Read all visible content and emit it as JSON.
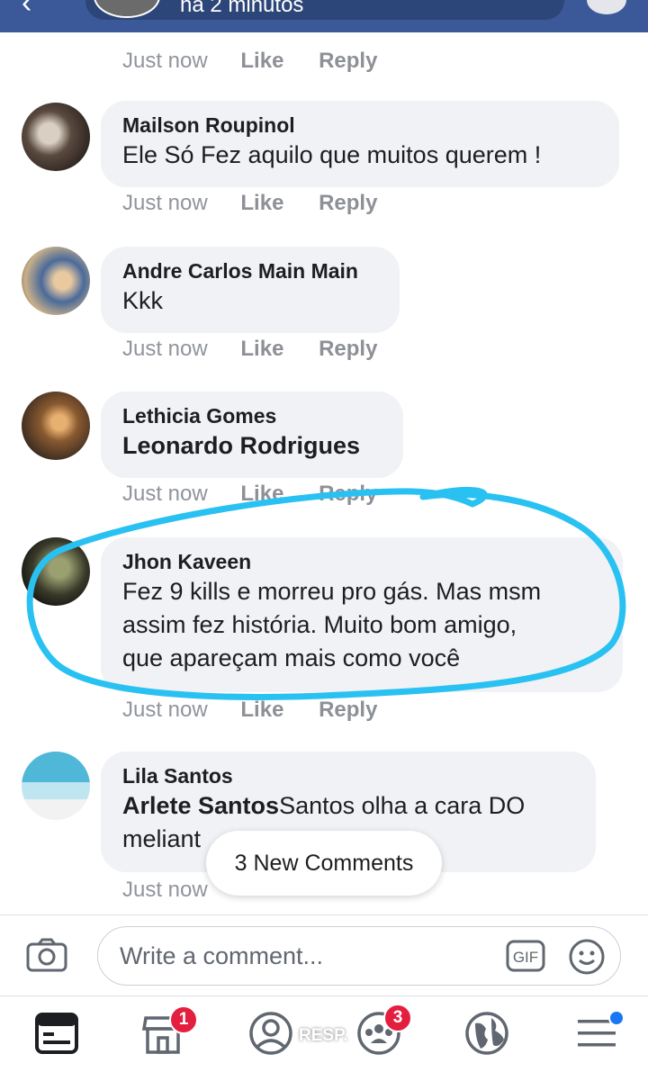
{
  "header": {
    "subtitle": "há 2 minutos"
  },
  "first_meta": {
    "time": "Just now",
    "like": "Like",
    "reply": "Reply"
  },
  "comments": [
    {
      "author": "Mailson Roupinol",
      "text": "Ele Só Fez aquilo que muitos querem !",
      "time": "Just now",
      "like": "Like",
      "reply": "Reply"
    },
    {
      "author": "Andre Carlos Main Main",
      "text": "Kkk",
      "time": "Just now",
      "like": "Like",
      "reply": "Reply"
    },
    {
      "author": "Lethicia Gomes",
      "tag": "Leonardo Rodrigues",
      "time": "Just now",
      "like": "Like",
      "reply": "Reply"
    },
    {
      "author": "Jhon Kaveen",
      "text_lines": [
        "Fez 9 kills e morreu pro gás. Mas msm",
        "assim fez história. Muito bom amigo,",
        "que apareçam mais como você"
      ],
      "time": "Just now",
      "like": "Like",
      "reply": "Reply"
    },
    {
      "author": "Lila Santos",
      "tag": "Arlete Santos",
      "text_a": "Santos olha a cara DO",
      "text_b": "meliant",
      "time": "Just now"
    }
  ],
  "new_comments": "3 New Comments",
  "composer": {
    "placeholder": "Write a comment...",
    "gif": "GIF"
  },
  "nav": {
    "marketplace_badge": "1",
    "groups_badge": "3",
    "resp_label": "RESP."
  },
  "colors": {
    "header": "#3b5998",
    "bubble": "#f0f2f5",
    "badge": "#e41e3f",
    "scribble": "#29c1f2"
  }
}
